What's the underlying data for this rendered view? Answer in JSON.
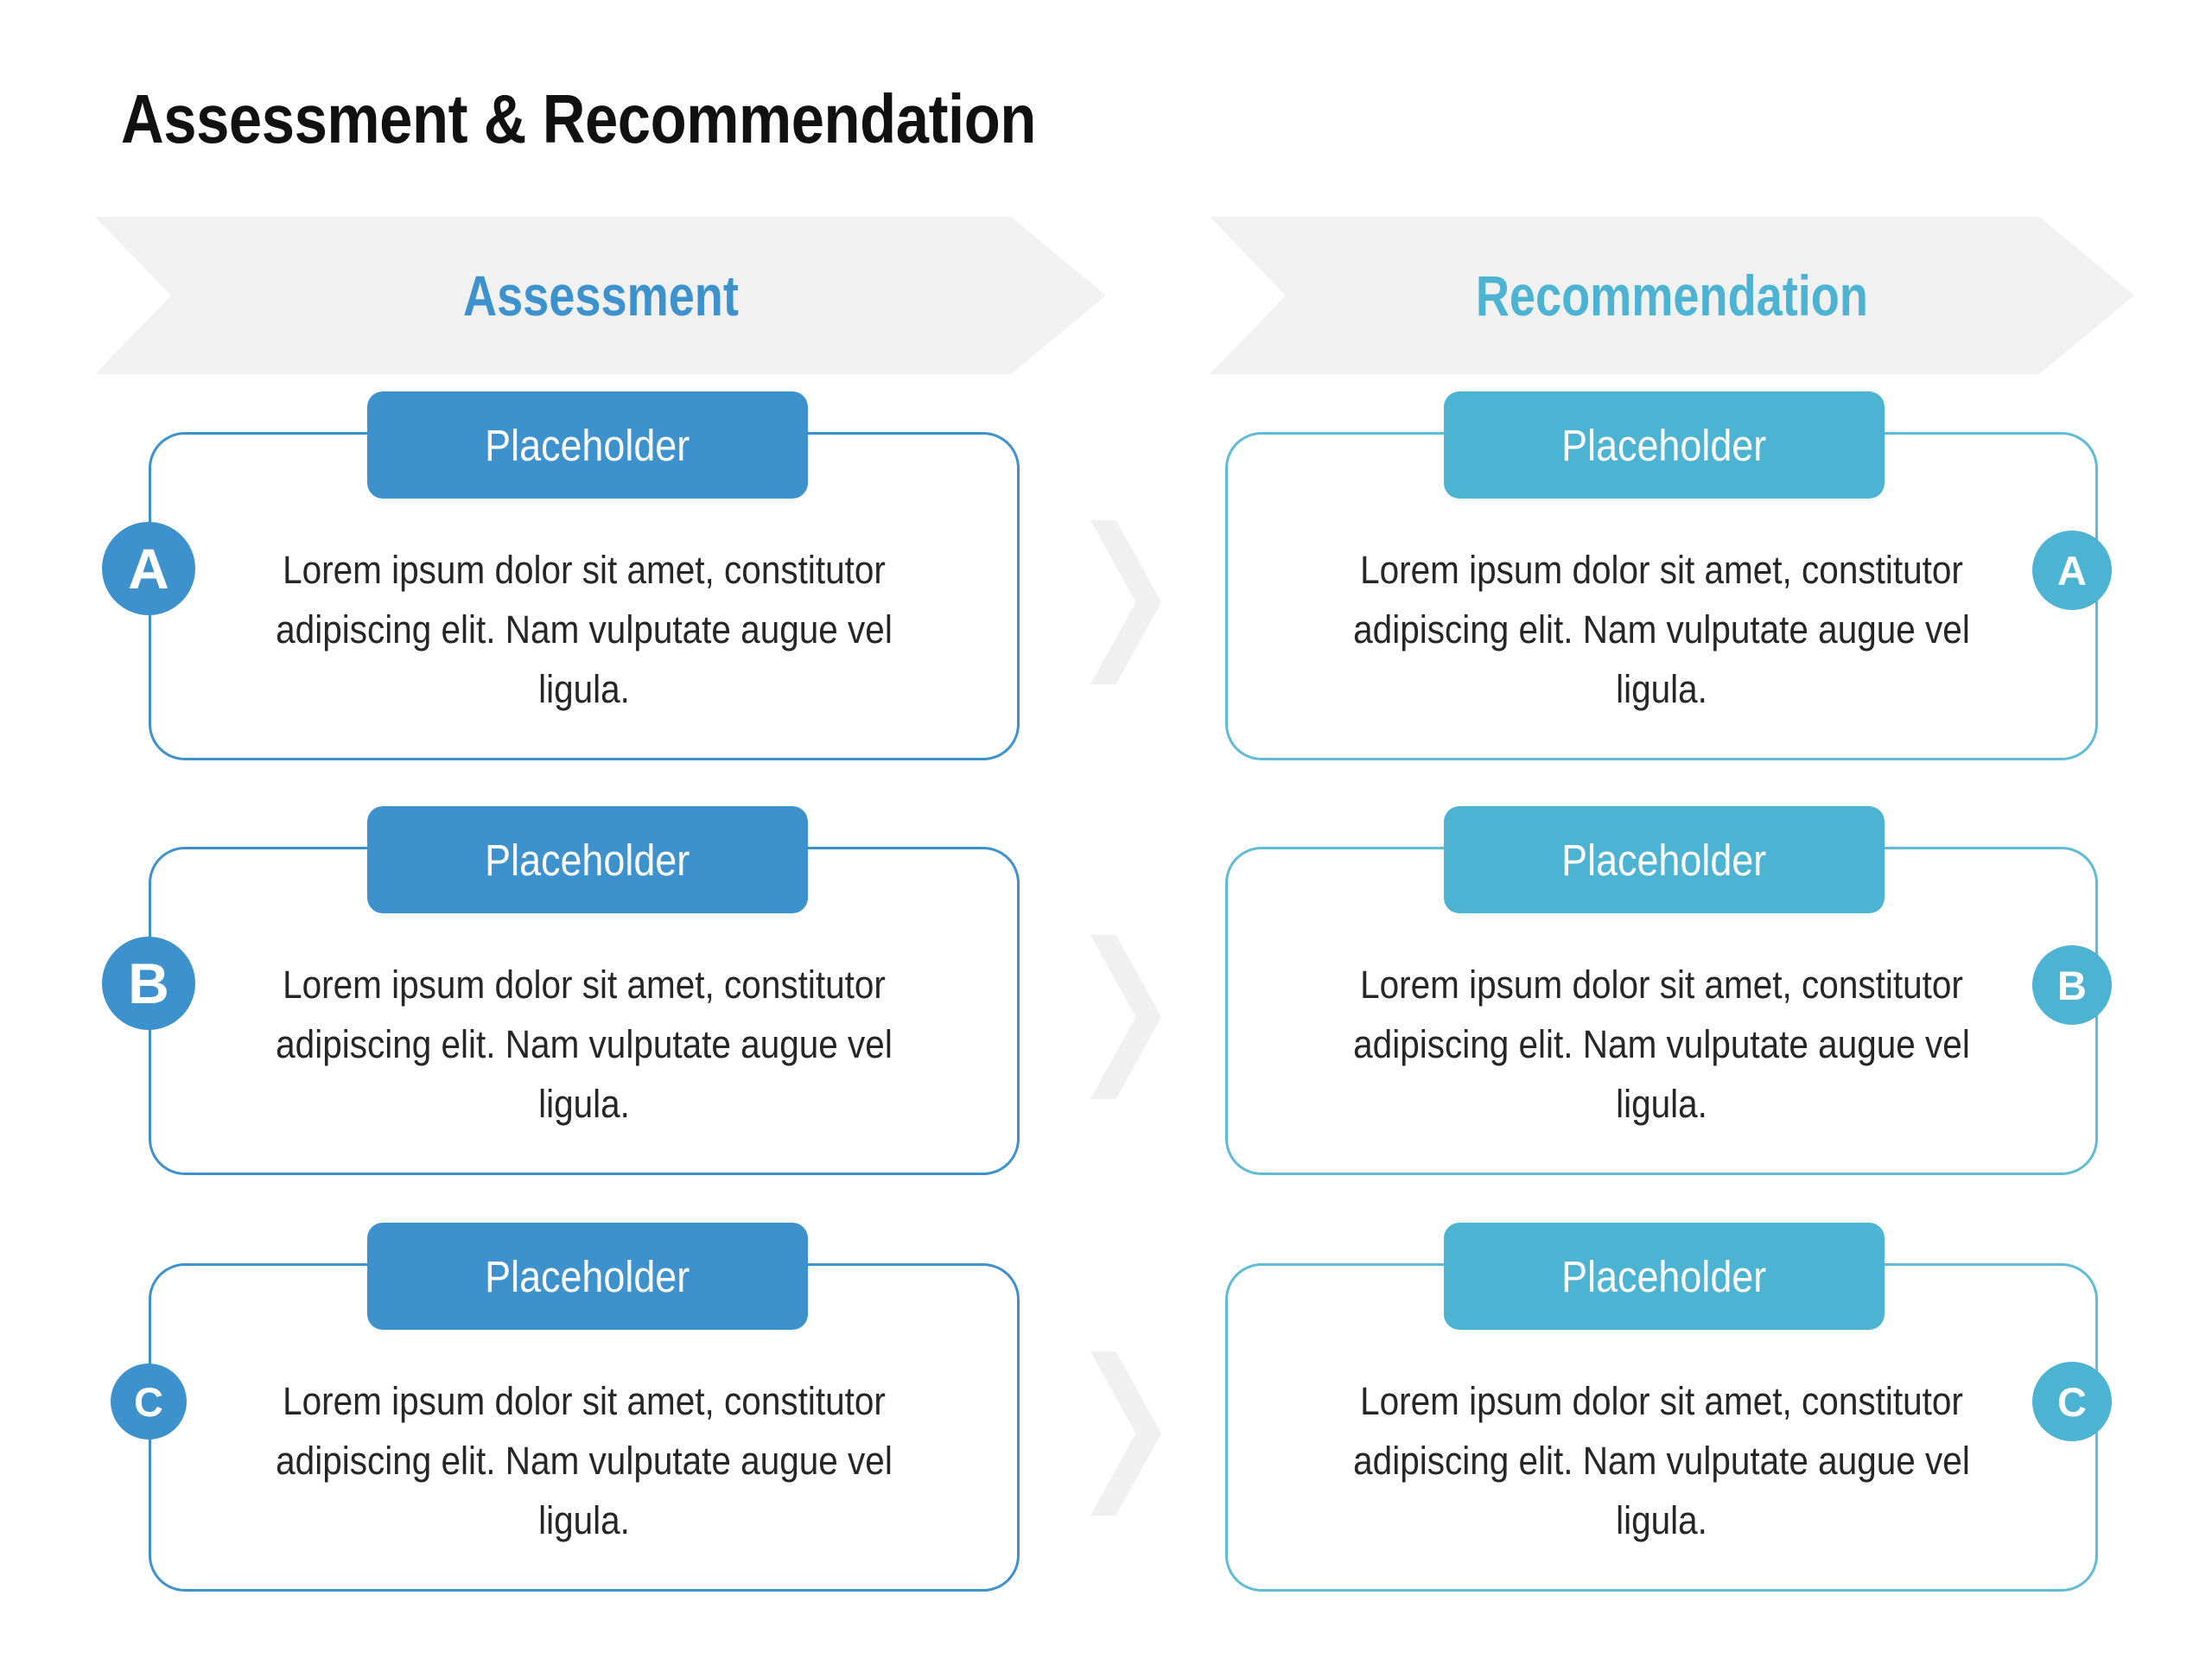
{
  "title": "Assessment & Recommendation",
  "columns": {
    "left": {
      "banner_label": "Assessment",
      "accent_color": "#3D92CE"
    },
    "right": {
      "banner_label": "Recommendation",
      "accent_color": "#4CB3D2"
    }
  },
  "connector_icon": "chevron-right-icon",
  "rows": [
    {
      "badge": "A",
      "left": {
        "tab_label": "Placeholder",
        "body": "Lorem ipsum dolor sit amet, constitutor adipiscing elit. Nam vulputate augue vel ligula."
      },
      "right": {
        "tab_label": "Placeholder",
        "body": "Lorem ipsum dolor sit amet, constitutor adipiscing elit. Nam vulputate augue vel ligula."
      }
    },
    {
      "badge": "B",
      "left": {
        "tab_label": "Placeholder",
        "body": "Lorem ipsum dolor sit amet, constitutor adipiscing elit. Nam vulputate augue vel ligula."
      },
      "right": {
        "tab_label": "Placeholder",
        "body": "Lorem ipsum dolor sit amet, constitutor adipiscing elit. Nam vulputate augue vel ligula."
      }
    },
    {
      "badge": "C",
      "left": {
        "tab_label": "Placeholder",
        "body": "Lorem ipsum dolor sit amet, constitutor adipiscing elit. Nam vulputate augue vel ligula."
      },
      "right": {
        "tab_label": "Placeholder",
        "body": "Lorem ipsum dolor sit amet, constitutor adipiscing elit. Nam vulputate augue vel ligula."
      }
    }
  ]
}
